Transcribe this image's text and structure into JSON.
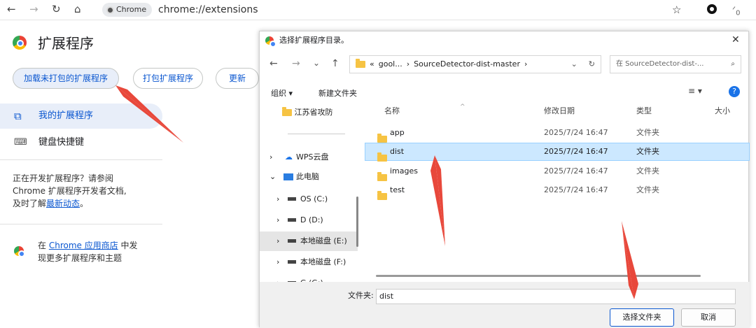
{
  "browser": {
    "chip_label": "Chrome",
    "url": "chrome://extensions",
    "nav": {
      "back": "←",
      "forward": "→",
      "reload": "↻",
      "home": "⌂"
    },
    "toolbar_icons": [
      "star-icon",
      "circle-icon",
      "extension-count-icon"
    ],
    "extension_badge": "0"
  },
  "ext_page": {
    "title": "扩展程序",
    "load_unpacked": "加载未打包的扩展程序",
    "pack": "打包扩展程序",
    "update": "更新",
    "sidebar": [
      {
        "label": "我的扩展程序",
        "icon": "puzzle-icon"
      },
      {
        "label": "键盘快捷键",
        "icon": "keyboard-icon"
      }
    ],
    "dev_note": {
      "line1": "正在开发扩展程序？请参阅",
      "line2": "Chrome 扩展程序开发者文档,",
      "line3_prefix": "及时了解",
      "line3_link": "最新动态",
      "line3_suffix": "。"
    },
    "store": {
      "prefix": "在 ",
      "link": "Chrome 应用商店",
      "suffix": " 中发",
      "line2": "现更多扩展程序和主题"
    }
  },
  "dialog": {
    "title": "选择扩展程序目录。",
    "close": "✕",
    "breadcrumb": [
      "«",
      "gool...",
      "›",
      "SourceDetector-dist-master",
      "›"
    ],
    "search_placeholder": "在 SourceDetector-dist-...",
    "organize": "组织 ▾",
    "new_folder": "新建文件夹",
    "view": "≡ ▾",
    "help": "?",
    "tree": [
      {
        "label": "江苏省攻防",
        "icon": "folder-icon",
        "arrow": ""
      },
      {
        "label": "WPS云盘",
        "icon": "cloud-icon",
        "arrow": "›"
      },
      {
        "label": "此电脑",
        "icon": "computer-icon",
        "arrow": "⌄"
      },
      {
        "label": "OS (C:)",
        "icon": "drive-icon",
        "arrow": "›"
      },
      {
        "label": "D (D:)",
        "icon": "drive-icon",
        "arrow": "›"
      },
      {
        "label": "本地磁盘 (E:)",
        "icon": "drive-icon",
        "arrow": "›"
      },
      {
        "label": "本地磁盘 (F:)",
        "icon": "drive-icon",
        "arrow": "›"
      },
      {
        "label": "G (G:)",
        "icon": "drive-icon",
        "arrow": "›"
      }
    ],
    "columns": [
      "名称",
      "修改日期",
      "类型",
      "大小"
    ],
    "files": [
      {
        "name": "app",
        "date": "2025/7/24 16:47",
        "type": "文件夹"
      },
      {
        "name": "dist",
        "date": "2025/7/24 16:47",
        "type": "文件夹"
      },
      {
        "name": "images",
        "date": "2025/7/24 16:47",
        "type": "文件夹"
      },
      {
        "name": "test",
        "date": "2025/7/24 16:47",
        "type": "文件夹"
      }
    ],
    "selected_index": 1,
    "folder_label": "文件夹:",
    "folder_value": "dist",
    "select_btn": "选择文件夹",
    "cancel_btn": "取消"
  },
  "colors": {
    "accent": "#0b57d0",
    "selected_row": "#cce8ff",
    "arrow": "#e8483b"
  }
}
